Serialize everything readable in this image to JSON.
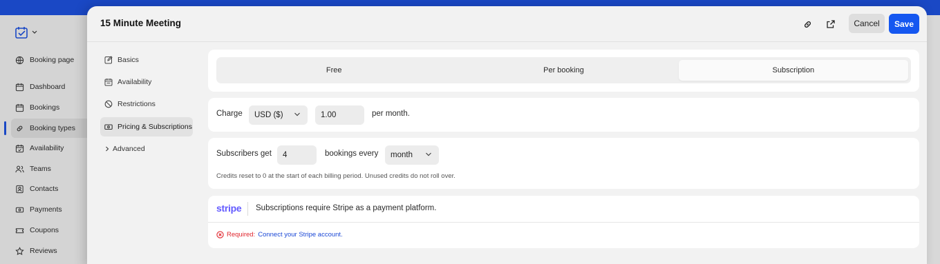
{
  "app": {
    "sidebar": [
      {
        "label": "Booking page",
        "icon": "globe-icon"
      },
      {
        "label": "Dashboard",
        "icon": "calendar-icon"
      },
      {
        "label": "Bookings",
        "icon": "calendar-icon"
      },
      {
        "label": "Booking types",
        "icon": "link-icon"
      },
      {
        "label": "Availability",
        "icon": "calendar-check-icon"
      },
      {
        "label": "Teams",
        "icon": "users-icon"
      },
      {
        "label": "Contacts",
        "icon": "contact-icon"
      },
      {
        "label": "Payments",
        "icon": "payment-icon"
      },
      {
        "label": "Coupons",
        "icon": "coupon-icon"
      },
      {
        "label": "Reviews",
        "icon": "star-icon"
      }
    ]
  },
  "modal": {
    "title": "15 Minute Meeting",
    "cancel_label": "Cancel",
    "save_label": "Save",
    "nav": [
      {
        "label": "Basics",
        "icon": "edit-icon"
      },
      {
        "label": "Availability",
        "icon": "calendar-icon"
      },
      {
        "label": "Restrictions",
        "icon": "ban-icon"
      },
      {
        "label": "Pricing & Subscriptions",
        "icon": "money-icon"
      },
      {
        "label": "Advanced",
        "icon": "chevron-right-icon"
      }
    ],
    "pricing": {
      "options": [
        "Free",
        "Per booking",
        "Subscription"
      ],
      "selected": "Subscription"
    },
    "charge": {
      "label": "Charge",
      "currency": "USD ($)",
      "amount": "1.00",
      "suffix": "per month."
    },
    "subscribers": {
      "label": "Subscribers get",
      "count": "4",
      "middle": "bookings every",
      "period": "month",
      "hint": "Credits reset to 0 at the start of each billing period. Unused credits do not roll over."
    },
    "stripe": {
      "logo": "stripe",
      "message": "Subscriptions require Stripe as a payment platform.",
      "required_label": "Required:",
      "connect_link": "Connect your Stripe account."
    }
  }
}
